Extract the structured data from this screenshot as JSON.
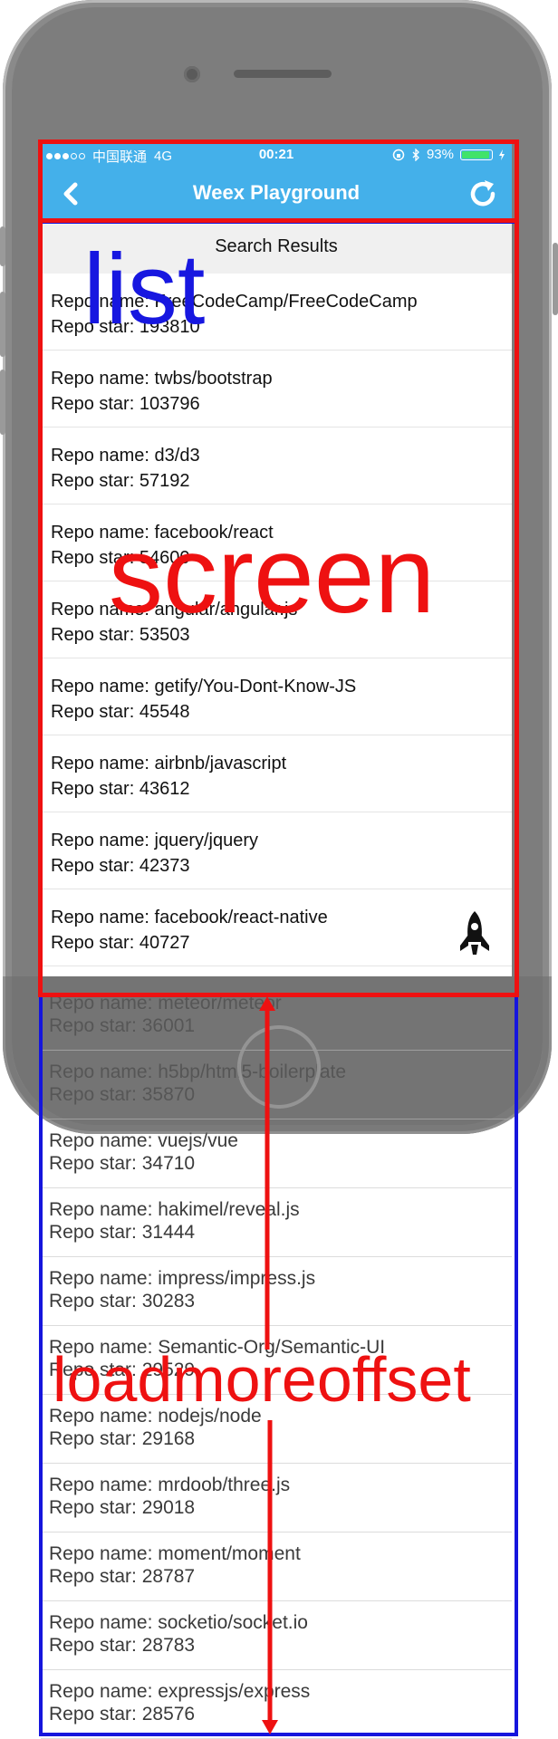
{
  "status_bar": {
    "carrier": "中国联通",
    "network": "4G",
    "time": "00:21",
    "battery": "93%",
    "battery_level": 0.93
  },
  "nav": {
    "title": "Weex Playground",
    "back_icon": "chevron-left-icon",
    "refresh_icon": "refresh-icon"
  },
  "list_header": "Search Results",
  "repos": [
    {
      "name": "Repo name: FreeCodeCamp/FreeCodeCamp",
      "star": "Repo star: 193810"
    },
    {
      "name": "Repo name: twbs/bootstrap",
      "star": "Repo star: 103796"
    },
    {
      "name": "Repo name: d3/d3",
      "star": "Repo star: 57192"
    },
    {
      "name": "Repo name: facebook/react",
      "star": "Repo star: 54600"
    },
    {
      "name": "Repo name: angular/angular.js",
      "star": "Repo star: 53503"
    },
    {
      "name": "Repo name: getify/You-Dont-Know-JS",
      "star": "Repo star: 45548"
    },
    {
      "name": "Repo name: airbnb/javascript",
      "star": "Repo star: 43612"
    },
    {
      "name": "Repo name: jquery/jquery",
      "star": "Repo star: 42373"
    },
    {
      "name": "Repo name: facebook/react-native",
      "star": "Repo star: 40727"
    }
  ],
  "more_repos": [
    {
      "name": "Repo name: meteor/meteor",
      "star": "Repo star: 36001"
    },
    {
      "name": "Repo name: h5bp/html5-boilerplate",
      "star": "Repo star: 35870"
    },
    {
      "name": "Repo name: vuejs/vue",
      "star": "Repo star: 34710"
    },
    {
      "name": "Repo name: hakimel/reveal.js",
      "star": "Repo star: 31444"
    },
    {
      "name": "Repo name: impress/impress.js",
      "star": "Repo star: 30283"
    },
    {
      "name": "Repo name: Semantic-Org/Semantic-UI",
      "star": "Repo star: 29529"
    },
    {
      "name": "Repo name: nodejs/node",
      "star": "Repo star: 29168"
    },
    {
      "name": "Repo name: mrdoob/three.js",
      "star": "Repo star: 29018"
    },
    {
      "name": "Repo name: moment/moment",
      "star": "Repo star: 28787"
    },
    {
      "name": "Repo name: socketio/socket.io",
      "star": "Repo star: 28783"
    },
    {
      "name": "Repo name: expressjs/express",
      "star": "Repo star: 28576"
    }
  ],
  "annotations": {
    "list_label": "list",
    "screen_label": "screen",
    "offset_label": "loadmoreoffset"
  },
  "colors": {
    "nav_blue": "#44b0ea",
    "annotation_red": "#ee1111",
    "annotation_blue": "#1515dd"
  },
  "floating_icon": "rocket-icon"
}
